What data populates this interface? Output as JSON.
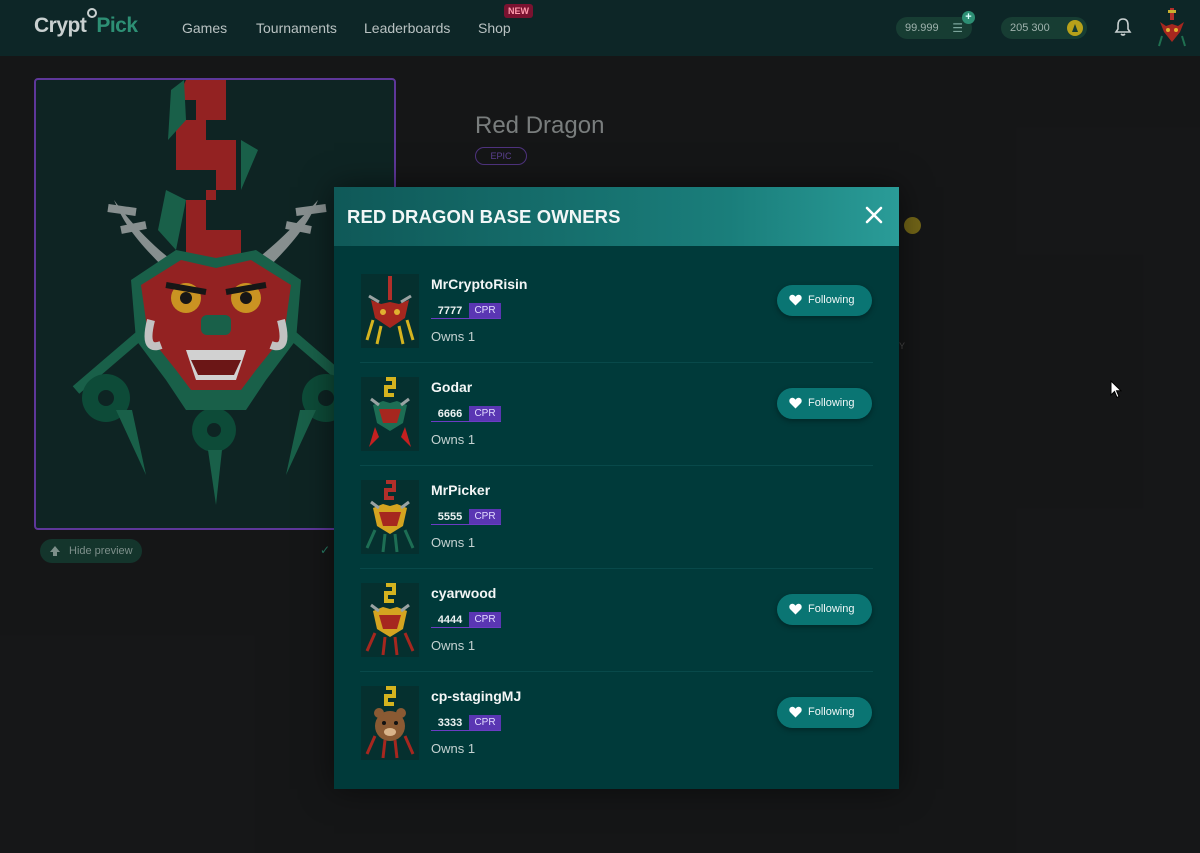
{
  "brand": {
    "part1": "Crypt",
    "part2": "Pick"
  },
  "nav": {
    "games": "Games",
    "tournaments": "Tournaments",
    "leaderboards": "Leaderboards",
    "shop": "Shop",
    "shop_badge": "NEW"
  },
  "wallet": {
    "balance_a": "99.999",
    "balance_b": "205 300"
  },
  "item": {
    "title": "Red Dragon",
    "rarity": "EPIC",
    "hide_preview": "Hide preview",
    "fragment_text": "Y"
  },
  "modal": {
    "title": "RED DRAGON BASE OWNERS",
    "owners": [
      {
        "name": "MrCryptoRisin",
        "score": "7777",
        "unit": "CPR",
        "owns": "Owns 1",
        "follow": "Following"
      },
      {
        "name": "Godar",
        "score": "6666",
        "unit": "CPR",
        "owns": "Owns 1",
        "follow": "Following"
      },
      {
        "name": "MrPicker",
        "score": "5555",
        "unit": "CPR",
        "owns": "Owns 1",
        "follow": ""
      },
      {
        "name": "cyarwood",
        "score": "4444",
        "unit": "CPR",
        "owns": "Owns 1",
        "follow": "Following"
      },
      {
        "name": "cp-stagingMJ",
        "score": "3333",
        "unit": "CPR",
        "owns": "Owns 1",
        "follow": "Following"
      }
    ]
  },
  "colors": {
    "accent": "#0a7573",
    "brand_green": "#2d8f74",
    "epic_purple": "#5a36b3",
    "modal_bg": "#003a3a"
  }
}
